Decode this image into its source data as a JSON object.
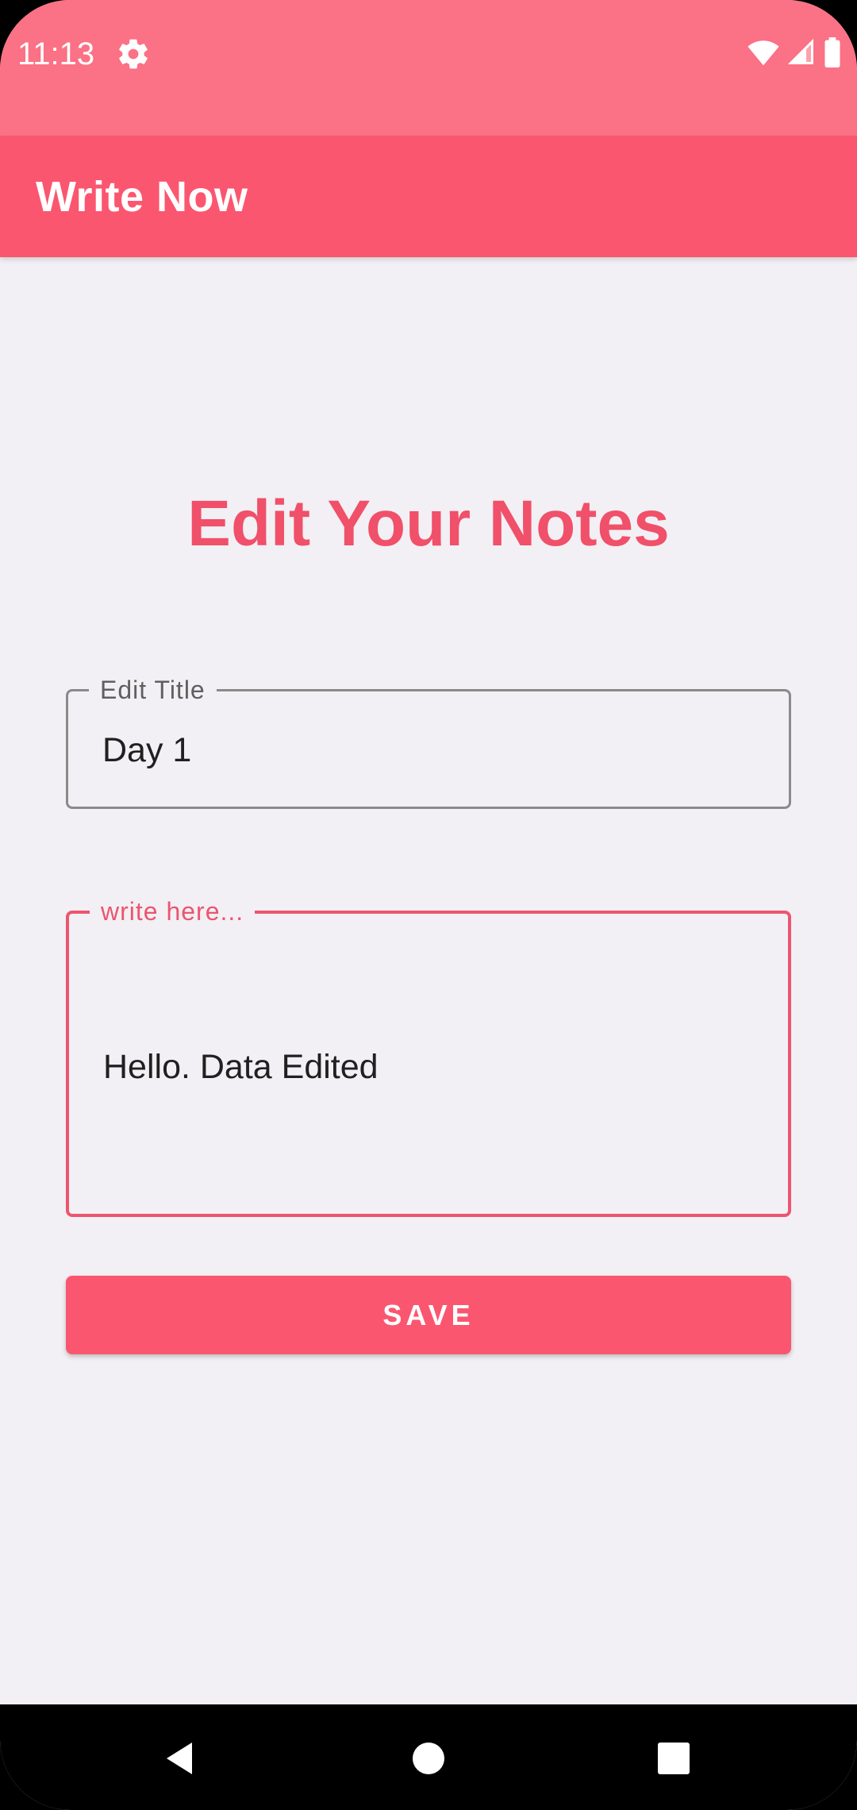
{
  "status_bar": {
    "time": "11:13",
    "icons": [
      "gear-icon",
      "wifi-icon",
      "signal-icon",
      "battery-icon"
    ]
  },
  "app_bar": {
    "title": "Write Now"
  },
  "main": {
    "heading": "Edit Your Notes",
    "title_field": {
      "label": "Edit Title",
      "value": "Day 1"
    },
    "body_field": {
      "label": "write here...",
      "value": "Hello. Data Edited"
    },
    "save_button": "SAVE"
  },
  "nav_bar": {
    "icons": [
      "back-icon",
      "home-icon",
      "recents-icon"
    ]
  },
  "colors": {
    "status_bar": "#fb7185",
    "app_bar": "#fb566f",
    "accent": "#ec5570",
    "background": "#f2f0f4"
  }
}
